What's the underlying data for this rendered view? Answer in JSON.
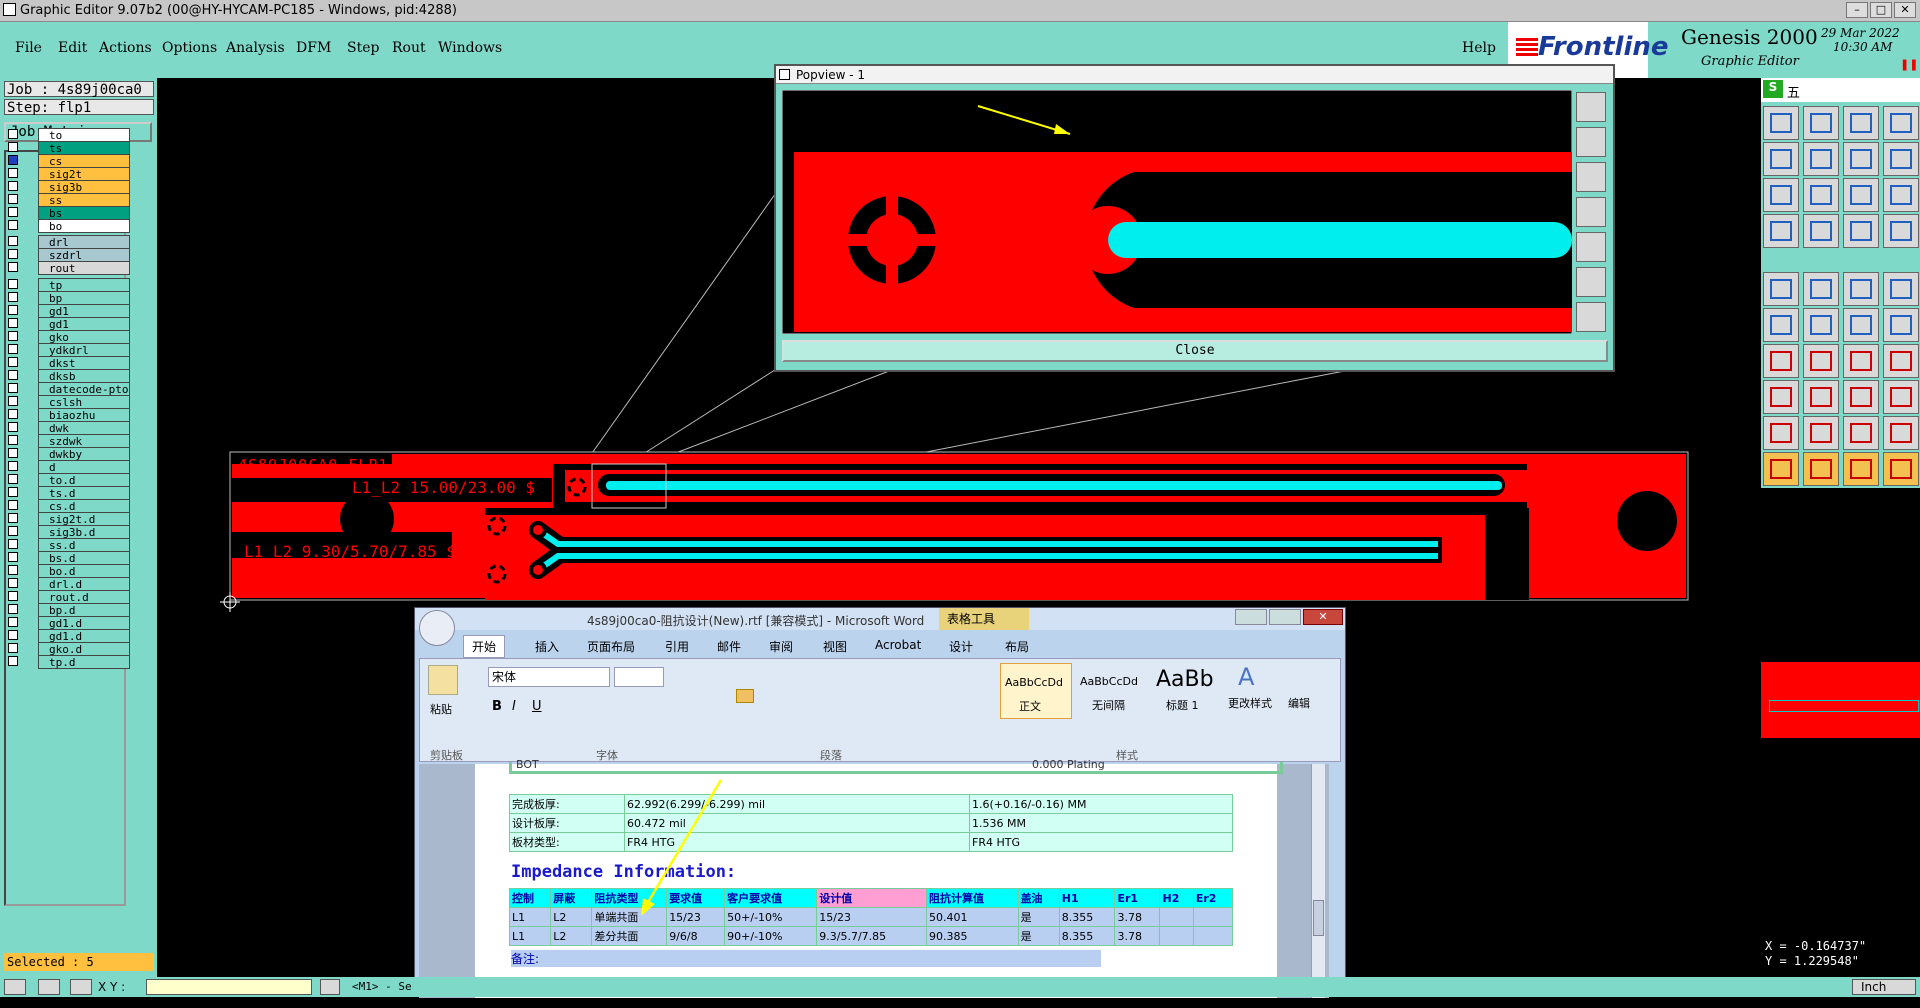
{
  "window": {
    "title": "Graphic Editor 9.07b2 (00@HY-HYCAM-PC185 - Windows, pid:4288)"
  },
  "menu": [
    "File",
    "Edit",
    "Actions",
    "Options",
    "Analysis",
    "DFM",
    "Step",
    "Rout",
    "Windows"
  ],
  "help": "Help",
  "brand": {
    "logo": "Frontline",
    "product": "Genesis 2000",
    "sub": "Graphic Editor",
    "date": "29 Mar 2022",
    "time": "10:30 AM"
  },
  "job": {
    "job_label": "Job : 4s89j00ca0",
    "step_label": "Step: flp1",
    "matrix_button": "Job Matrix ..."
  },
  "layers": [
    {
      "name": "to",
      "color": "#ffffff"
    },
    {
      "name": "ts",
      "color": "#00a080"
    },
    {
      "name": "cs",
      "color": "#ffc040"
    },
    {
      "name": "sig2t",
      "color": "#ffc040"
    },
    {
      "name": "sig3b",
      "color": "#ffc040"
    },
    {
      "name": "ss",
      "color": "#ffc040"
    },
    {
      "name": "bs",
      "color": "#00a080"
    },
    {
      "name": "bo",
      "color": "#ffffff"
    }
  ],
  "drill_layers": [
    {
      "name": "drl",
      "color": "#a8c8d0"
    },
    {
      "name": "szdrl",
      "color": "#a8c8d0"
    },
    {
      "name": "rout",
      "color": "#d8d8d8"
    }
  ],
  "misc_layers": [
    "tp",
    "bp",
    "gd1",
    "gd1",
    "gko",
    "ydkdrl",
    "dkst",
    "dksb",
    "datecode-pto",
    "cslsh",
    "biaozhu",
    "dwk",
    "szdwk",
    "dwkby",
    "d",
    "to.d",
    "ts.d",
    "cs.d",
    "sig2t.d",
    "sig3b.d",
    "ss.d",
    "bs.d",
    "bo.d",
    "drl.d",
    "rout.d",
    "bp.d",
    "gd1.d",
    "gd1.d",
    "gko.d",
    "tp.d"
  ],
  "selected": "Selected : 5",
  "status": {
    "xy_label": "X Y :",
    "m1": "<M1> - Se",
    "units": "Inch"
  },
  "coords": {
    "x": "X = -0.164737\"",
    "y": "Y = 1.229548\""
  },
  "canvas": {
    "label1": "4S89J00CA0 FLP1",
    "label2": "L1_L2 15.00/23.00 $",
    "label3": "L1_L2 9.30/5.70/7.85 $"
  },
  "popview": {
    "title": "Popview - 1",
    "close": "Close"
  },
  "ime": {
    "text": "五"
  },
  "word": {
    "title": "4s89j00ca0-阻抗设计(New).rtf [兼容模式] - Microsoft Word",
    "context": "表格工具",
    "tabs": [
      "开始",
      "插入",
      "页面布局",
      "引用",
      "邮件",
      "审阅",
      "视图",
      "Acrobat",
      "设计",
      "布局"
    ],
    "font_name": "宋体",
    "styles": [
      {
        "sample": "AaBbCcDd",
        "name": "正文"
      },
      {
        "sample": "AaBbCcDd",
        "name": "无间隔"
      },
      {
        "sample": "AaBb",
        "name": "标题 1"
      }
    ],
    "change_style": "更改样式",
    "edit": "编辑",
    "paste": "粘贴",
    "groups": [
      "剪贴板",
      "字体",
      "段落",
      "样式"
    ],
    "rows": [
      {
        "k": "完成板厚:",
        "v1": "62.992(6.299/-6.299) mil",
        "v2": "1.6(+0.16/-0.16) MM"
      },
      {
        "k": "设计板厚:",
        "v1": "60.472 mil",
        "v2": "1.536 MM"
      },
      {
        "k": "板材类型:",
        "v1": "FR4 HTG",
        "v2": "FR4 HTG"
      }
    ],
    "heading": "Impedance Information:",
    "headers": [
      "控制",
      "屏蔽",
      "阻抗类型",
      "要求值",
      "客户要求值",
      "设计值",
      "阻抗计算值",
      "盖油",
      "H1",
      "Er1",
      "H2",
      "Er2"
    ],
    "imp_rows": [
      [
        "L1",
        "L2",
        "单端共面",
        "15/23",
        "50+/-10%",
        "15/23",
        "50.401",
        "是",
        "8.355",
        "3.78",
        "",
        ""
      ],
      [
        "L1",
        "L2",
        "差分共面",
        "9/6/8",
        "90+/-10%",
        "9.3/5.7/7.85",
        "90.385",
        "是",
        "8.355",
        "3.78",
        "",
        ""
      ]
    ],
    "remark": "备注:",
    "top_cut": "BOT",
    "top_cut2": "0.000 Plating"
  }
}
